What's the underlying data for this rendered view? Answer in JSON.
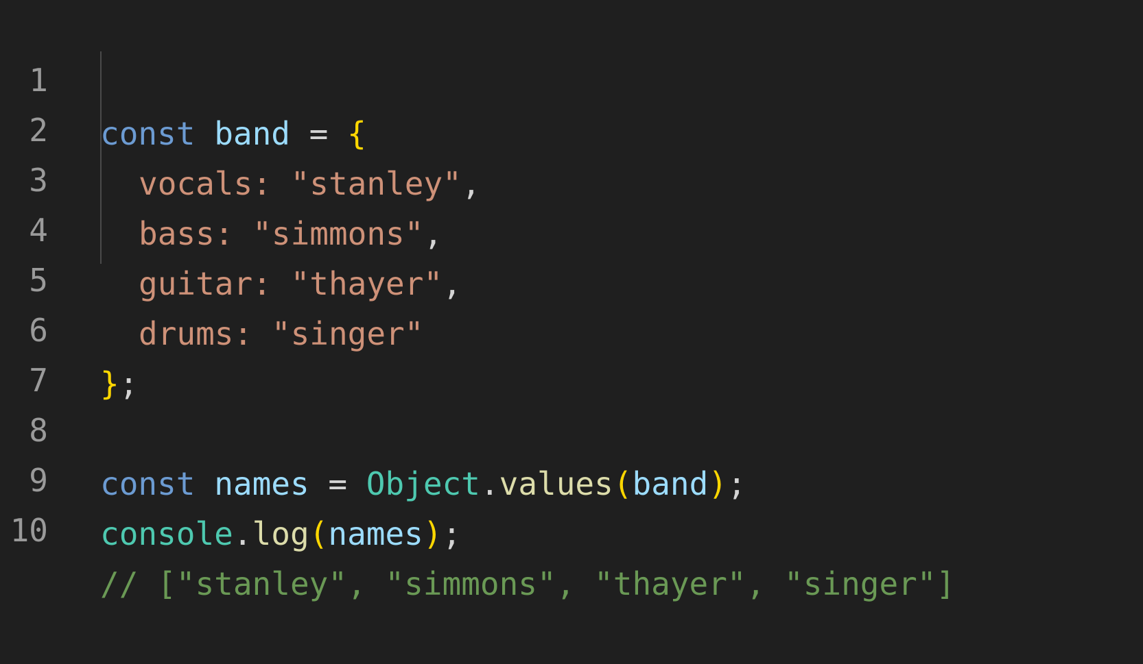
{
  "editor": {
    "lines": [
      {
        "number": "1"
      },
      {
        "number": "2"
      },
      {
        "number": "3"
      },
      {
        "number": "4"
      },
      {
        "number": "5"
      },
      {
        "number": "6"
      },
      {
        "number": "7"
      },
      {
        "number": "8"
      },
      {
        "number": "9"
      },
      {
        "number": "10"
      }
    ],
    "tokens": {
      "l1_const": "const",
      "l1_var": "band",
      "l1_eq": "=",
      "l1_brace": "{",
      "l2_key": "vocals:",
      "l2_val": "\"stanley\"",
      "l2_comma": ",",
      "l3_key": "bass:",
      "l3_val": "\"simmons\"",
      "l3_comma": ",",
      "l4_key": "guitar:",
      "l4_val": "\"thayer\"",
      "l4_comma": ",",
      "l5_key": "drums:",
      "l5_val": "\"singer\"",
      "l6_brace": "}",
      "l6_semi": ";",
      "l8_const": "const",
      "l8_var": "names",
      "l8_eq": "=",
      "l8_class": "Object",
      "l8_dot": ".",
      "l8_fn": "values",
      "l8_open": "(",
      "l8_arg": "band",
      "l8_close": ")",
      "l8_semi": ";",
      "l9_obj": "console",
      "l9_dot": ".",
      "l9_fn": "log",
      "l9_open": "(",
      "l9_arg": "names",
      "l9_close": ")",
      "l9_semi": ";",
      "l10_comment": "// [\"stanley\", \"simmons\", \"thayer\", \"singer\"]"
    }
  },
  "colors": {
    "background": "#1f1f1f",
    "keyword": "#6c9bd2",
    "variable": "#9cdcfe",
    "string": "#ce9178",
    "bracket": "#ffd700",
    "class": "#4ec9b0",
    "function": "#dcdcaa",
    "comment": "#6a9955",
    "line_number": "#9a9a9a"
  }
}
